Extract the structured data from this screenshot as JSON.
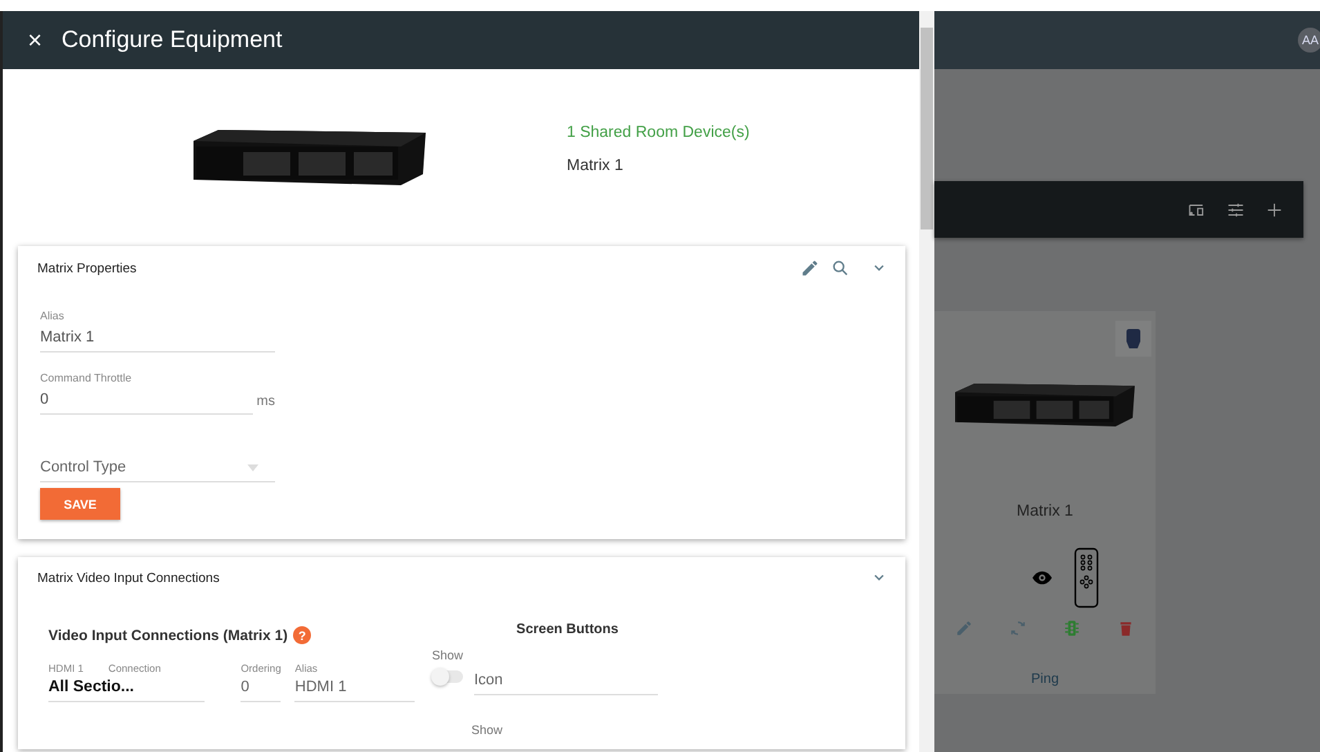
{
  "dialog": {
    "title": "Configure Equipment",
    "close_icon": "×"
  },
  "device": {
    "shared_count": "1 Shared Room Device(s)",
    "name": "Matrix 1"
  },
  "properties": {
    "title": "Matrix Properties",
    "save_label": "SAVE",
    "fields": [
      {
        "kind": "text",
        "label": "Alias",
        "value": "Matrix 1"
      },
      {
        "kind": "text",
        "label": "Command Throttle",
        "value": "0",
        "suffix": "ms"
      },
      {
        "kind": "select",
        "placeholder": "Control Type"
      }
    ]
  },
  "video_inputs": {
    "title": "Matrix Video Input Connections",
    "heading": "Video Input Connections (Matrix 1)",
    "help_icon": "?",
    "screen_buttons_heading": "Screen Buttons",
    "rows": [
      {
        "input": "HDMI 1",
        "connection_label": "Connection",
        "connection": "All Sectio...",
        "ordering_label": "Ordering",
        "ordering": "0",
        "alias_label": "Alias",
        "alias": "HDMI 1",
        "show_label": "Show",
        "show": false,
        "icon_placeholder": "Icon"
      }
    ],
    "next_show_label": "Show"
  },
  "background": {
    "avatar": "AA",
    "device_card": {
      "name": "Matrix 1",
      "action": "Ping"
    }
  }
}
